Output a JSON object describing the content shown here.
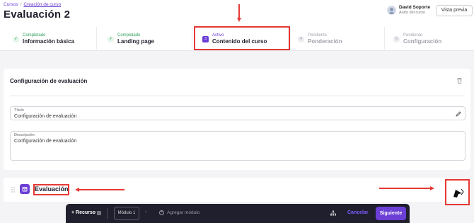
{
  "breadcrumb": {
    "root": "Cursos",
    "separator": "/",
    "current": "Creación de curso"
  },
  "page": {
    "title": "Evaluación 2"
  },
  "user": {
    "name": "David Soporte",
    "role": "Autor del curso"
  },
  "header": {
    "preview_label": "Vista previa"
  },
  "steps": [
    {
      "status": "Completado",
      "name": "Información básica",
      "badge": "✓"
    },
    {
      "status": "Completado",
      "name": "Landing page",
      "badge": "✓"
    },
    {
      "status": "Activo",
      "name": "Contenido del curso",
      "badge": "3"
    },
    {
      "status": "Pendiente",
      "name": "Ponderación",
      "badge": "4"
    },
    {
      "status": "Pendiente",
      "name": "Configuración",
      "badge": "5"
    }
  ],
  "config": {
    "title": "Configuración de evaluación",
    "titulo_label": "Título",
    "titulo_value": "Configuración de evaluación",
    "descripcion_label": "Descripción",
    "descripcion_value": "Configuración de evaluación"
  },
  "evaluation": {
    "label": "Evaluación"
  },
  "bottombar": {
    "recurso_label": "+ Recurso",
    "modulo_label": "Módulo 1",
    "chevron": "›",
    "add_module_label": "Agregar módulo",
    "cancel_label": "Cancelar",
    "next_label": "Siguiente"
  },
  "colors": {
    "accent": "#6b3fd6",
    "annotation": "#e53935",
    "success": "#2f9e5a",
    "bar": "#1f1f2e"
  },
  "icons": [
    "check-icon",
    "trash-icon",
    "pencil-icon",
    "drag-handle-icon",
    "evaluation-icon",
    "menu-icon",
    "plus-circle-icon",
    "tree-icon",
    "cursor-icon"
  ]
}
